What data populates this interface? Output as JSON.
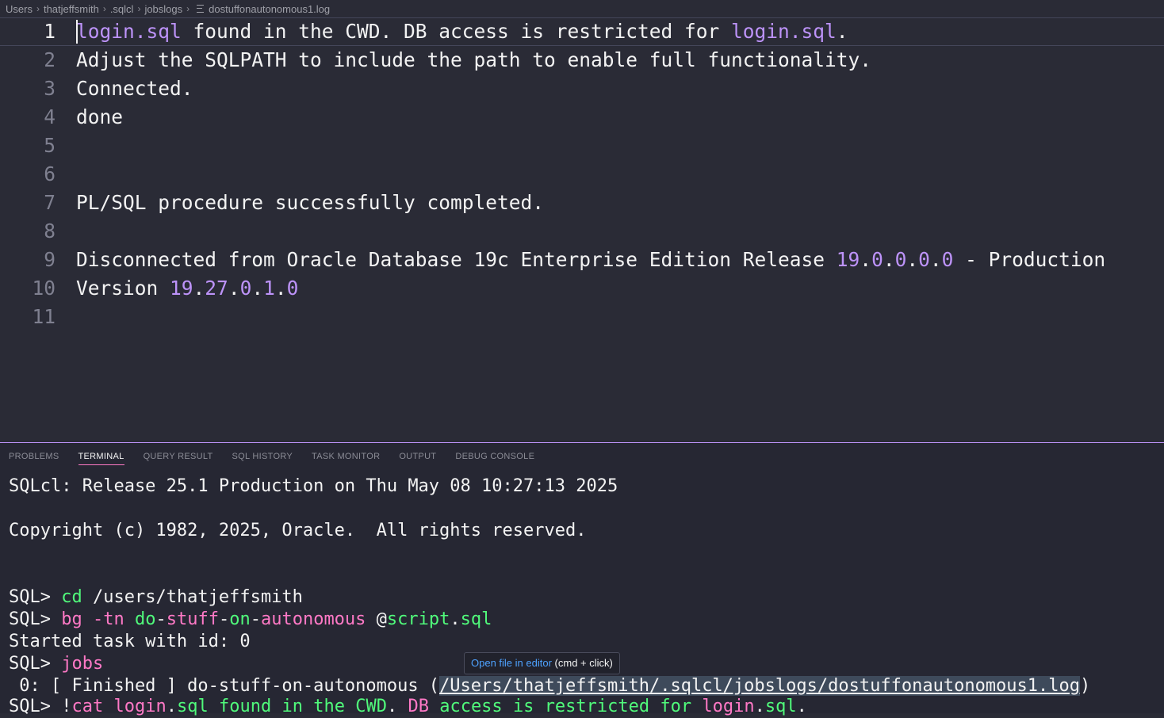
{
  "breadcrumb": [
    "Users",
    "thatjeffsmith",
    ".sqlcl",
    "jobslogs",
    "dostuffonautonomous1.log"
  ],
  "editor": {
    "lines": [
      {
        "num": "1",
        "segments": [
          {
            "t": "login.sql",
            "c": "purple"
          },
          {
            "t": " found in the CWD. DB access is restricted for "
          },
          {
            "t": "login.sql",
            "c": "purple"
          },
          {
            "t": "."
          }
        ]
      },
      {
        "num": "2",
        "segments": [
          {
            "t": "Adjust the SQLPATH to include the path to enable full functionality."
          }
        ]
      },
      {
        "num": "3",
        "segments": [
          {
            "t": "Connected."
          }
        ]
      },
      {
        "num": "4",
        "segments": [
          {
            "t": "done"
          }
        ]
      },
      {
        "num": "5",
        "segments": []
      },
      {
        "num": "6",
        "segments": []
      },
      {
        "num": "7",
        "segments": [
          {
            "t": "PL/SQL procedure successfully completed."
          }
        ]
      },
      {
        "num": "8",
        "segments": []
      },
      {
        "num": "9",
        "segments": [
          {
            "t": "Disconnected from Oracle Database 19c Enterprise Edition Release "
          },
          {
            "t": "19",
            "c": "purple"
          },
          {
            "t": "."
          },
          {
            "t": "0",
            "c": "purple"
          },
          {
            "t": "."
          },
          {
            "t": "0",
            "c": "purple"
          },
          {
            "t": "."
          },
          {
            "t": "0",
            "c": "purple"
          },
          {
            "t": "."
          },
          {
            "t": "0",
            "c": "purple"
          },
          {
            "t": " - Production"
          }
        ]
      },
      {
        "num": "10",
        "segments": [
          {
            "t": "Version "
          },
          {
            "t": "19",
            "c": "purple"
          },
          {
            "t": "."
          },
          {
            "t": "27",
            "c": "purple"
          },
          {
            "t": "."
          },
          {
            "t": "0",
            "c": "purple"
          },
          {
            "t": "."
          },
          {
            "t": "1",
            "c": "purple"
          },
          {
            "t": "."
          },
          {
            "t": "0",
            "c": "purple"
          }
        ]
      },
      {
        "num": "11",
        "segments": []
      }
    ]
  },
  "panel": {
    "tabs": [
      "PROBLEMS",
      "TERMINAL",
      "QUERY RESULT",
      "SQL HISTORY",
      "TASK MONITOR",
      "OUTPUT",
      "DEBUG CONSOLE"
    ],
    "active_tab": "TERMINAL"
  },
  "terminal": {
    "lines": [
      {
        "segments": [
          {
            "t": "SQLcl: Release 25.1 Production on Thu May 08 10:27:13 2025"
          }
        ]
      },
      {
        "segments": [
          {
            "t": "Copyright (c) 1982, 2025, Oracle.  All rights reserved."
          }
        ]
      },
      {
        "segments": [
          {
            "t": "SQL> "
          },
          {
            "t": "cd",
            "c": "green"
          },
          {
            "t": " /users/thatjeffsmith"
          }
        ]
      },
      {
        "segments": [
          {
            "t": "SQL> "
          },
          {
            "t": "bg",
            "c": "pink"
          },
          {
            "t": " "
          },
          {
            "t": "-tn",
            "c": "pink"
          },
          {
            "t": " "
          },
          {
            "t": "do",
            "c": "green"
          },
          {
            "t": "-"
          },
          {
            "t": "stuff",
            "c": "pink"
          },
          {
            "t": "-"
          },
          {
            "t": "on",
            "c": "green"
          },
          {
            "t": "-"
          },
          {
            "t": "autonomous",
            "c": "pink"
          },
          {
            "t": " @"
          },
          {
            "t": "script",
            "c": "green"
          },
          {
            "t": "."
          },
          {
            "t": "sql",
            "c": "green"
          }
        ]
      },
      {
        "segments": [
          {
            "t": "Started task with id: 0"
          }
        ]
      },
      {
        "segments": [
          {
            "t": "SQL> "
          },
          {
            "t": "jobs",
            "c": "pink"
          }
        ]
      },
      {
        "segments": [
          {
            "t": " 0: [ Finished ] do-stuff-on-autonomous ("
          },
          {
            "t": "/Users/thatjeffsmith/.sqlcl/jobslogs/dostuffonautonomous1.log",
            "c": "link"
          },
          {
            "t": ")"
          }
        ]
      },
      {
        "segments": [
          {
            "t": "SQL> !"
          },
          {
            "t": "cat",
            "c": "pink"
          },
          {
            "t": " "
          },
          {
            "t": "login",
            "c": "pink"
          },
          {
            "t": "."
          },
          {
            "t": "sql",
            "c": "green"
          },
          {
            "t": " "
          },
          {
            "t": "found",
            "c": "green"
          },
          {
            "t": " "
          },
          {
            "t": "in",
            "c": "green"
          },
          {
            "t": " "
          },
          {
            "t": "the",
            "c": "green"
          },
          {
            "t": " "
          },
          {
            "t": "CWD",
            "c": "green"
          },
          {
            "t": ". "
          },
          {
            "t": "DB",
            "c": "pink"
          },
          {
            "t": " "
          },
          {
            "t": "access",
            "c": "green"
          },
          {
            "t": " "
          },
          {
            "t": "is",
            "c": "green"
          },
          {
            "t": " "
          },
          {
            "t": "restricted",
            "c": "green"
          },
          {
            "t": " "
          },
          {
            "t": "for",
            "c": "green"
          },
          {
            "t": " "
          },
          {
            "t": "login",
            "c": "pink"
          },
          {
            "t": "."
          },
          {
            "t": "sql",
            "c": "green"
          },
          {
            "t": "."
          }
        ]
      }
    ]
  },
  "tooltip": {
    "link_text": "Open file in editor",
    "hint": "(cmd + click)"
  }
}
